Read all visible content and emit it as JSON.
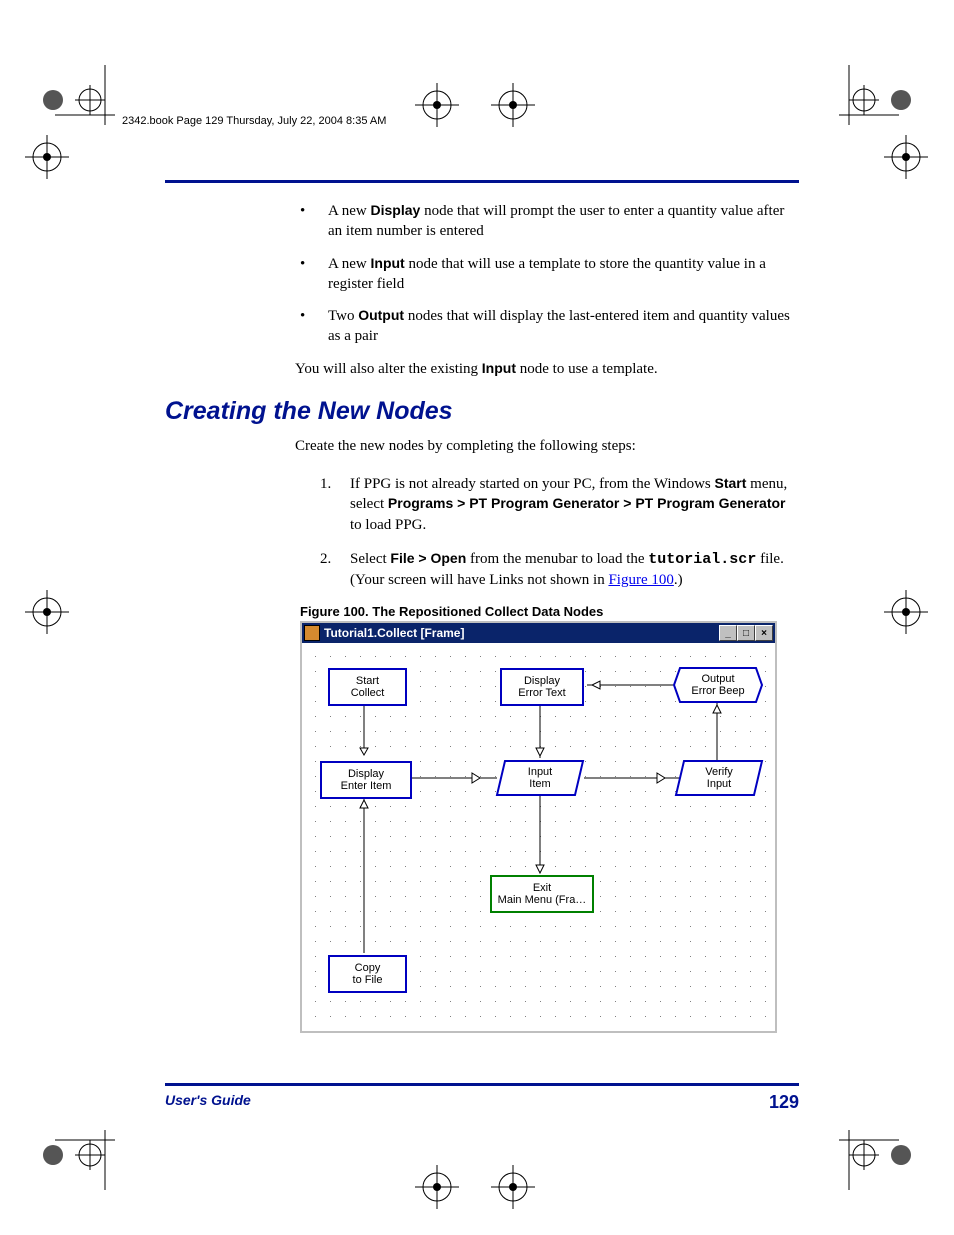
{
  "header_line": "2342.book  Page 129  Thursday, July 22, 2004  8:35 AM",
  "bullets": {
    "b1_pre": "A new ",
    "b1_bold": "Display",
    "b1_post": " node that will prompt the user to enter a quantity value after an item number is entered",
    "b2_pre": "A new ",
    "b2_bold": "Input",
    "b2_post": " node that will use a template to store the quantity value in a register field",
    "b3_pre": "Two ",
    "b3_bold": "Output",
    "b3_post": " nodes that will display the last-entered item and quantity values as a pair"
  },
  "alter_para_pre": "You will also alter the existing ",
  "alter_para_bold": "Input",
  "alter_para_post": " node to use a template.",
  "h2": "Creating the New Nodes",
  "intro_para": "Create the new nodes by completing the following steps:",
  "steps": {
    "s1_a": "If PPG is not already started on your PC, from the Windows ",
    "s1_start": "Start",
    "s1_b": " menu, select ",
    "s1_path": "Programs > PT Program Generator > PT Program Generator",
    "s1_c": " to load PPG.",
    "s2_a": "Select ",
    "s2_menu": "File > Open",
    "s2_b": " from the menubar to load the ",
    "s2_file": "tutorial.scr",
    "s2_c": " file. (Your screen will have Links not shown in ",
    "s2_link": "Figure 100",
    "s2_d": ".)"
  },
  "figure_caption": "Figure 100. The Repositioned Collect Data Nodes",
  "window_title": "Tutorial1.Collect [Frame]",
  "winbtns": {
    "min": "_",
    "max": "□",
    "close": "×"
  },
  "nodes": {
    "start1": "Start",
    "start2": "Collect",
    "disp_err1": "Display",
    "disp_err2": "Error Text",
    "out_beep1": "Output",
    "out_beep2": "Error Beep",
    "disp_enter1": "Display",
    "disp_enter2": "Enter Item",
    "input1": "Input",
    "input2": "Item",
    "verify1": "Verify",
    "verify2": "Input",
    "exit1": "Exit",
    "exit2": "Main Menu (Fra…",
    "copy1": "Copy",
    "copy2": "to File"
  },
  "footer_left": "User's Guide",
  "footer_page": "129"
}
